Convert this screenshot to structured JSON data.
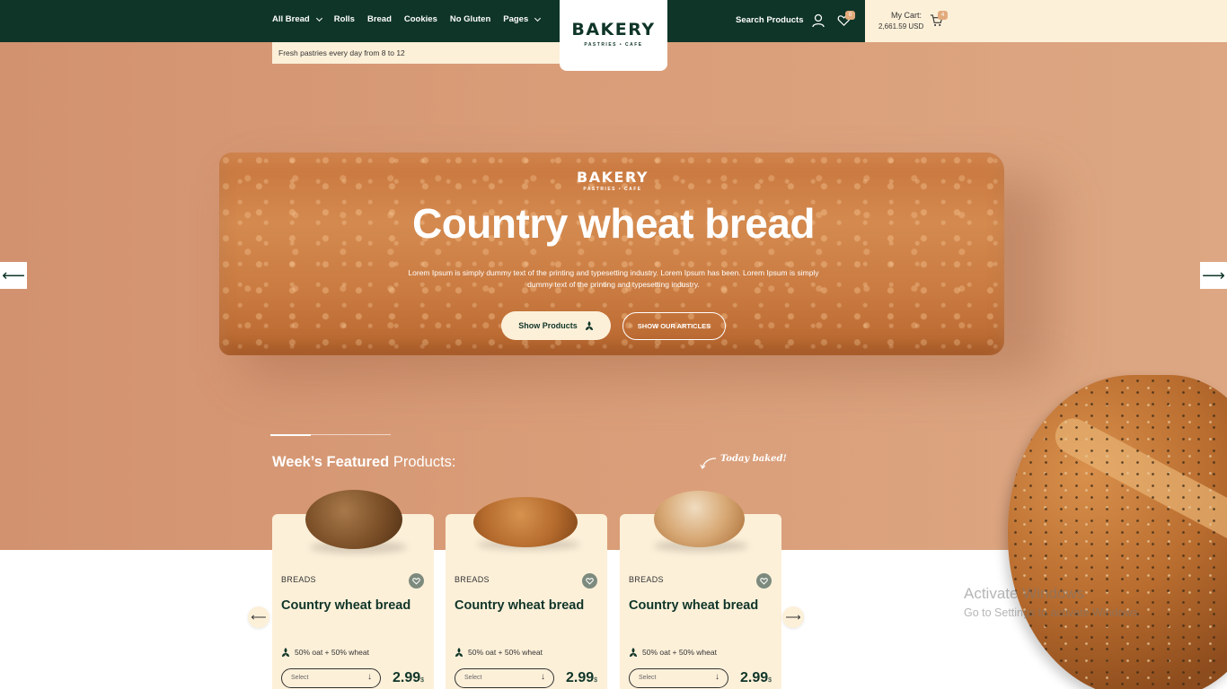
{
  "nav": {
    "items": [
      {
        "label": "All Bread",
        "dropdown": true
      },
      {
        "label": "Rolls",
        "dropdown": false
      },
      {
        "label": "Bread",
        "dropdown": false
      },
      {
        "label": "Cookies",
        "dropdown": false
      },
      {
        "label": "No Gluten",
        "dropdown": false
      },
      {
        "label": "Pages",
        "dropdown": true
      }
    ]
  },
  "logo": {
    "title": "BAKERY",
    "subtitle": "PASTRIES • CAFE"
  },
  "header": {
    "search_label": "Search Products",
    "wishlist_count": "0",
    "cart_label": "My Cart:",
    "cart_total": "2,661.59 USD",
    "cart_count": "4"
  },
  "notice": "Fresh pastries every day from 8 to 12",
  "hero": {
    "logo_title": "BAKERY",
    "logo_subtitle": "PASTRIES • CAFE",
    "title": "Country wheat bread",
    "description": "Lorem Ipsum is simply dummy text of the printing and typesetting industry. Lorem Ipsum has been. Lorem Ipsum is simply dummy text of the printing and typesetting industry.",
    "primary_button": "Show Products",
    "secondary_button": "SHOW OUR ARTICLES",
    "prev_arrow": "⟵",
    "next_arrow": "⟶"
  },
  "featured": {
    "title_bold": "Week’s Featured",
    "title_rest": " Products:",
    "tagline": "Today baked!",
    "prev_arrow": "⟵",
    "next_arrow": "⟶",
    "products": [
      {
        "category": "BREADS",
        "name": "Country wheat bread",
        "mix": "50% oat + 50% wheat",
        "select": "Select",
        "price": "2.99",
        "currency": "$"
      },
      {
        "category": "BREADS",
        "name": "Country wheat bread",
        "mix": "50% oat + 50% wheat",
        "select": "Select",
        "price": "2.99",
        "currency": "$"
      },
      {
        "category": "BREADS",
        "name": "Country wheat bread",
        "mix": "50% oat + 50% wheat",
        "select": "Select",
        "price": "2.99",
        "currency": "$"
      }
    ]
  },
  "watermark": {
    "line1": "Activate Windows",
    "line2": "Go to Settings to activate Windows."
  },
  "colors": {
    "primary": "#0f3528",
    "cream": "#fdf0d9",
    "hero_bg": "#d99d78",
    "badge": "#e2ab7c"
  }
}
